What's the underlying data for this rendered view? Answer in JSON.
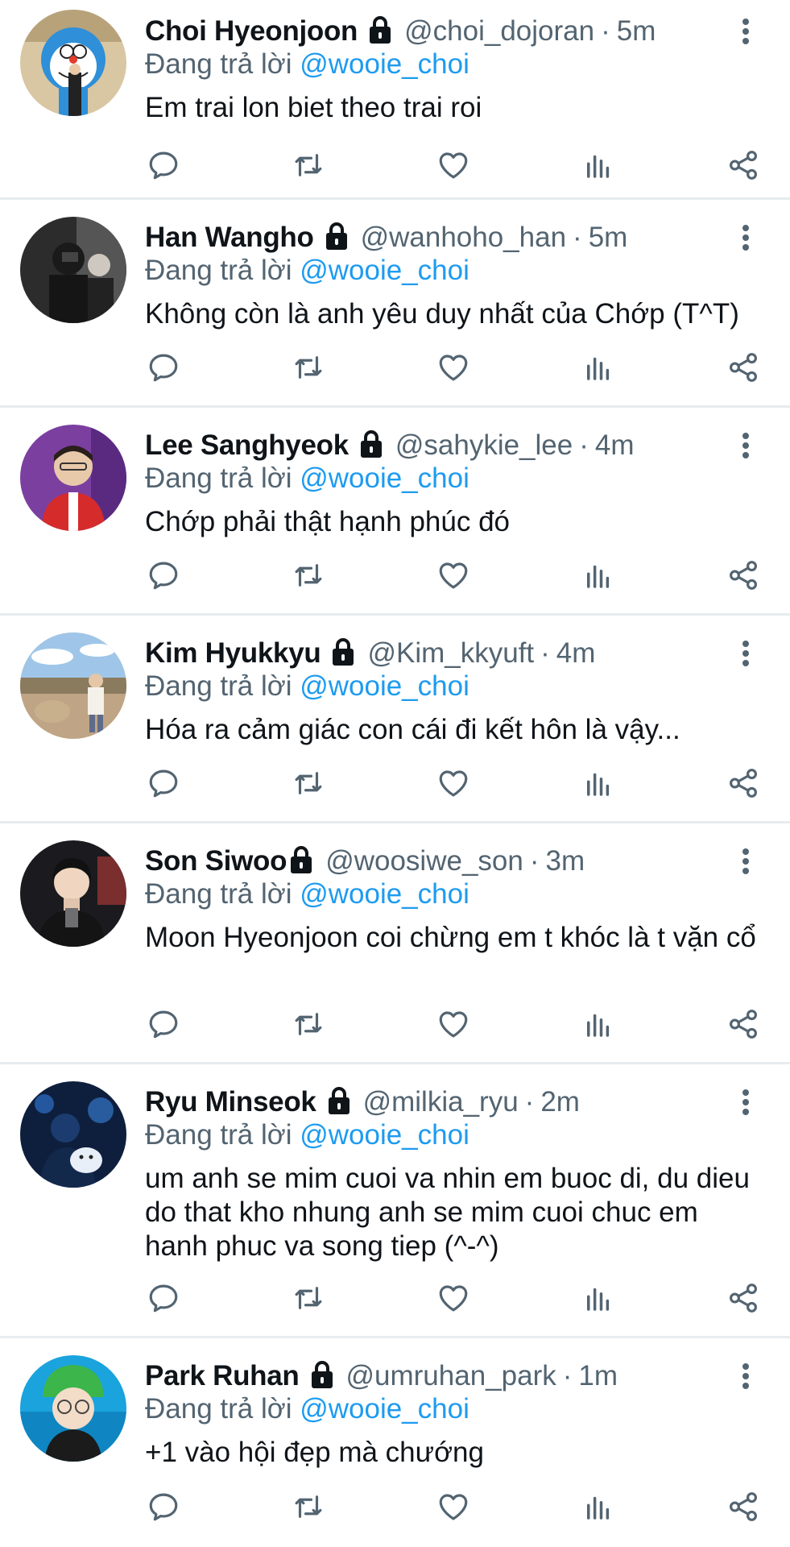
{
  "reply_prefix": "Đang trả lời",
  "colors": {
    "link": "#1d9bf0",
    "secondary": "#536471",
    "text": "#0f1419",
    "divider": "#e6ecf0"
  },
  "action_icons": [
    "reply-icon",
    "retweet-icon",
    "like-icon",
    "views-icon",
    "share-icon"
  ],
  "tweets": [
    {
      "name": "Choi Hyeonjoon",
      "handle": "@choi_dojoran",
      "time": "5m",
      "mention": "@wooie_choi",
      "text": "Em trai lon biet theo trai roi",
      "avatar_icon": "avatar-cartoon-icon"
    },
    {
      "name": "Han Wangho",
      "handle": "@wanhoho_han",
      "time": "5m",
      "mention": "@wooie_choi",
      "text": "Không còn là anh yêu duy nhất của Chớp (T^T)",
      "avatar_icon": "avatar-dark-photo-icon"
    },
    {
      "name": "Lee Sanghyeok",
      "handle": "@sahykie_lee",
      "time": "4m",
      "mention": "@wooie_choi",
      "text": "Chớp phải thật hạnh phúc đó",
      "avatar_icon": "avatar-purple-photo-icon"
    },
    {
      "name": "Kim Hyukkyu",
      "handle": "@Kim_kkyuft",
      "time": "4m",
      "mention": "@wooie_choi",
      "text": "Hóa ra cảm giác con cái đi kết hôn là vậy...",
      "avatar_icon": "avatar-outdoor-photo-icon"
    },
    {
      "name": "Son Siwoo",
      "handle": "@woosiwe_son",
      "time": "3m",
      "mention": "@wooie_choi",
      "text": "Moon Hyeonjoon coi chừng em t khóc là t vặn cổ",
      "avatar_icon": "avatar-portrait-photo-icon"
    },
    {
      "name": "Ryu Minseok",
      "handle": "@milkia_ryu",
      "time": "2m",
      "mention": "@wooie_choi",
      "text": "um anh se mim cuoi va nhin em buoc di, du dieu do that kho nhung anh se mim cuoi chuc em hanh phuc va song tiep (^-^)",
      "avatar_icon": "avatar-blue-photo-icon"
    },
    {
      "name": "Park Ruhan",
      "handle": "@umruhan_park",
      "time": "1m",
      "mention": "@wooie_choi",
      "text": "+1 vào hội đẹp mà chướng",
      "avatar_icon": "avatar-green-hat-photo-icon"
    }
  ]
}
